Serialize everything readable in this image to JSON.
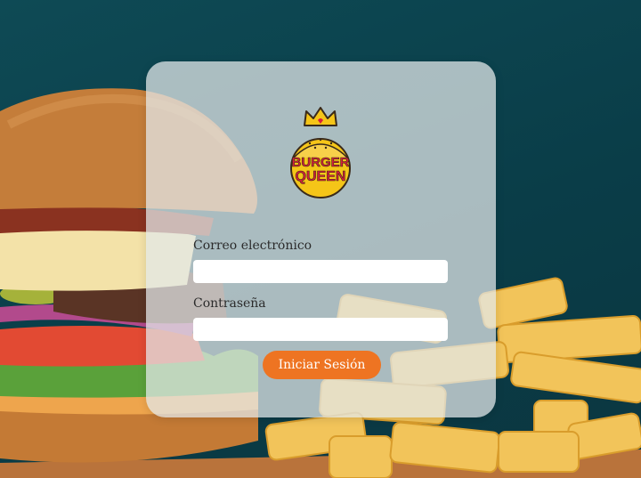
{
  "brand": {
    "logo_line1": "BURGER",
    "logo_line2": "QUEEN",
    "colors": {
      "accent": "#ee7422",
      "logo_yellow": "#f5c518",
      "logo_red": "#d81f3b",
      "background": "#0e4a55"
    }
  },
  "login": {
    "email_label": "Correo electrónico",
    "email_value": "",
    "password_label": "Contraseña",
    "password_value": "",
    "submit_label": "Iniciar Sesión"
  },
  "icons": {
    "logo": "burger-queen-crown-logo"
  }
}
